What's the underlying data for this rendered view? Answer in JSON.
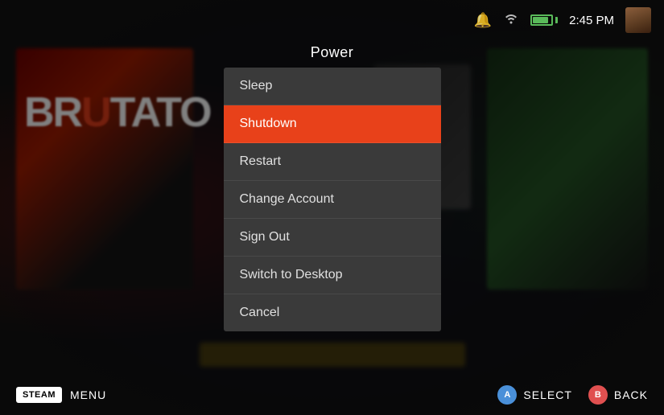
{
  "background": {
    "game_title": "BRUTATO"
  },
  "topbar": {
    "time": "2:45 PM",
    "battery_level": 80
  },
  "dialog": {
    "title": "Power",
    "menu_items": [
      {
        "id": "sleep",
        "label": "Sleep",
        "active": false
      },
      {
        "id": "shutdown",
        "label": "Shutdown",
        "active": true
      },
      {
        "id": "restart",
        "label": "Restart",
        "active": false
      },
      {
        "id": "change-account",
        "label": "Change Account",
        "active": false
      },
      {
        "id": "sign-out",
        "label": "Sign Out",
        "active": false
      },
      {
        "id": "switch-desktop",
        "label": "Switch to Desktop",
        "active": false
      },
      {
        "id": "cancel",
        "label": "Cancel",
        "active": false
      }
    ]
  },
  "bottombar": {
    "steam_label": "STEAM",
    "menu_label": "MENU",
    "select_label": "SELECT",
    "back_label": "BACK",
    "btn_a_label": "A",
    "btn_b_label": "B"
  }
}
